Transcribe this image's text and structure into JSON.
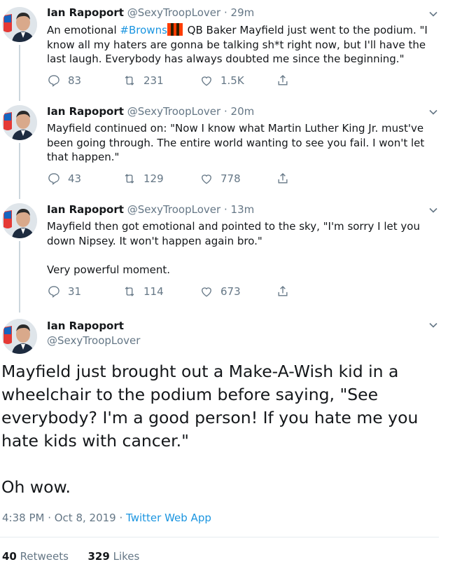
{
  "author": {
    "name": "Ian Rapoport",
    "handle": "@SexyTroopLover"
  },
  "tweets": [
    {
      "time": "29m",
      "pre": "An emotional ",
      "hashtag": "#Browns",
      "text": " QB Baker Mayfield just went to the podium. \"I know all my haters are gonna be talking sh*t right now, but I'll have the last laugh. Everybody has always doubted me since the beginning.\"",
      "replies": "83",
      "retweets": "231",
      "likes": "1.5K"
    },
    {
      "time": "20m",
      "text": "Mayfield continued on: \"Now I know what Martin Luther King Jr. must've been going through. The entire world wanting to see you fail. I won't let that happen.\"",
      "replies": "43",
      "retweets": "129",
      "likes": "778"
    },
    {
      "time": "13m",
      "text": "Mayfield then got emotional and pointed to the sky, \"I'm sorry I let you down Nipsey. It won't happen again bro.\"",
      "text2": "Very powerful moment.",
      "replies": "31",
      "retweets": "114",
      "likes": "673"
    }
  ],
  "main_tweet": {
    "text": "Mayfield just brought out a Make-A-Wish kid in a wheelchair to the podium before saying, \"See everybody? I'm a good person! If you hate me you hate kids with cancer.\"",
    "text2": "Oh wow.",
    "timestamp": "4:38 PM · Oct 8, 2019",
    "separator": "·",
    "source": "Twitter Web App",
    "retweets_count": "40",
    "retweets_label": "Retweets",
    "likes_count": "329",
    "likes_label": "Likes"
  },
  "colors": {
    "link": "#1b95e0",
    "muted": "#657786",
    "browns_orange": "#ff3c00",
    "browns_brown": "#311d00"
  },
  "icons": [
    "reply-icon",
    "retweet-icon",
    "like-icon",
    "share-icon",
    "chevron-down-icon",
    "browns-flag-icon"
  ]
}
